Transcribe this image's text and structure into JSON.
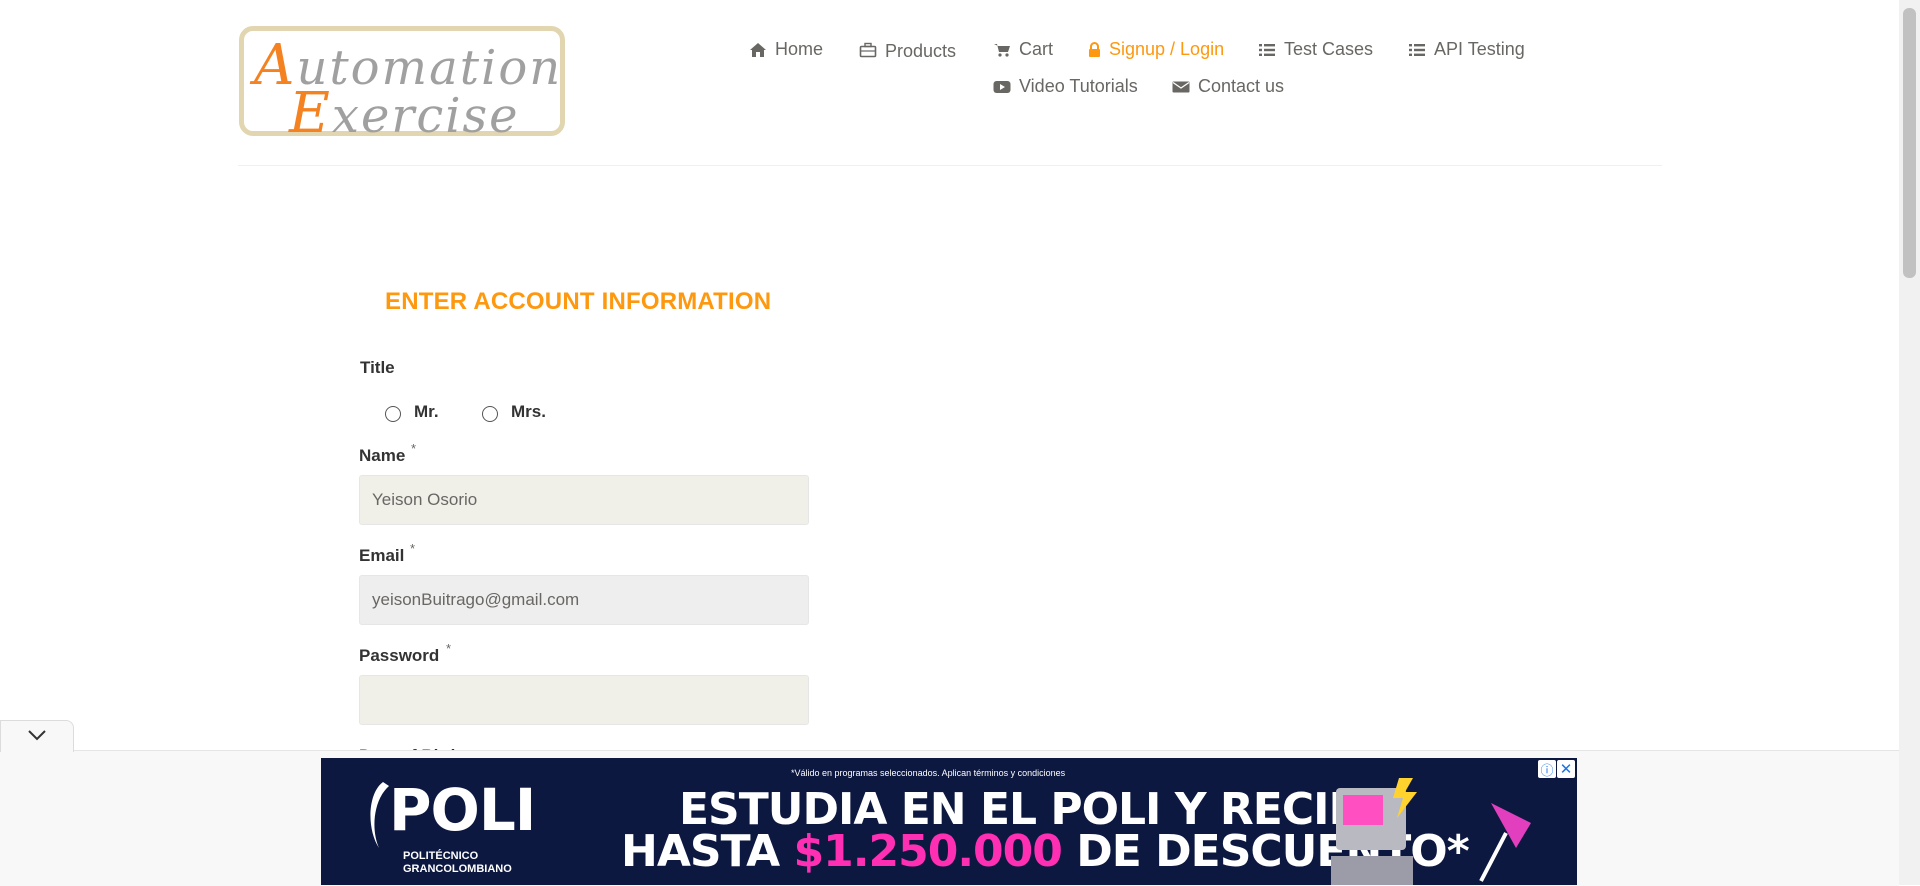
{
  "header": {
    "logo": {
      "line1_cap": "A",
      "line1_rest": "utomation",
      "line2_cap": "E",
      "line2_rest": "xercise"
    },
    "nav": [
      {
        "label": "Home",
        "icon": "home-icon"
      },
      {
        "label": "Products",
        "icon": "briefcase-icon"
      },
      {
        "label": "Cart",
        "icon": "cart-icon"
      },
      {
        "label": "Signup / Login",
        "icon": "lock-icon",
        "active": true
      },
      {
        "label": "Test Cases",
        "icon": "list-icon"
      },
      {
        "label": "API Testing",
        "icon": "list-icon"
      },
      {
        "label": "Video Tutorials",
        "icon": "youtube-play-icon"
      },
      {
        "label": "Contact us",
        "icon": "envelope-icon"
      }
    ],
    "active_color": "#fe980f"
  },
  "form": {
    "heading": "ENTER ACCOUNT INFORMATION",
    "title_label": "Title",
    "title_options": [
      "Mr.",
      "Mrs."
    ],
    "name_label": "Name",
    "name_value": "Yeison Osorio",
    "email_label": "Email",
    "email_value": "yeisonBuitrago@gmail.com",
    "password_label": "Password",
    "password_value": "",
    "required_mark": "*",
    "next_label_partial": "Date of Birth"
  },
  "ad": {
    "fine_print": "*Válido en programas seleccionados. Aplican términos y condiciones",
    "logo_text": "POLI",
    "logo_sub": "POLITÉCNICO GRANCOLOMBIANO",
    "headline_1": "ESTUDIA EN EL POLI Y RECIBE",
    "headline_2_pre": "HASTA ",
    "headline_2_amount": "$1.250.000",
    "headline_2_post": " DE DESCUENTO*",
    "info_icon": "ⓘ",
    "close_icon": "✕"
  }
}
